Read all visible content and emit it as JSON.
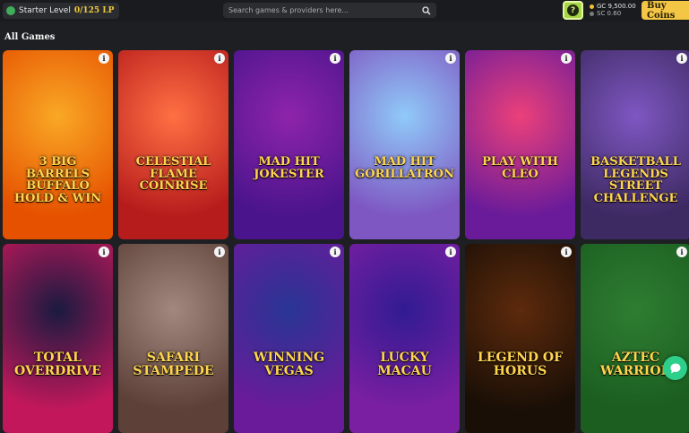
{
  "topbar": {
    "level_label": "Starter Level",
    "level_lp": "0/125 LP",
    "search_placeholder": "Search games & providers here...",
    "help_label": "?",
    "gc_balance": "GC 9,500.00",
    "sc_balance": "SC 0.60",
    "buy_label": "Buy Coins"
  },
  "main": {
    "section_title": "All Games",
    "info_glyph": "i",
    "games": [
      {
        "title": "3 BIG BARRELS BUFFALO HOLD & WIN",
        "colors": [
          "#f9a825",
          "#e65100"
        ]
      },
      {
        "title": "CELESTIAL FLAME COINRISE",
        "colors": [
          "#ff7043",
          "#b71c1c"
        ]
      },
      {
        "title": "MAD HIT JOKESTER",
        "colors": [
          "#8e24aa",
          "#4a148c"
        ]
      },
      {
        "title": "MAD HIT GORILLATRON",
        "colors": [
          "#90caf9",
          "#7e57c2"
        ]
      },
      {
        "title": "PLAY WITH CLEO",
        "colors": [
          "#ec407a",
          "#6a1b9a"
        ]
      },
      {
        "title": "BASKETBALL LEGENDS STREET CHALLENGE",
        "colors": [
          "#7e57c2",
          "#3e2a63"
        ]
      },
      {
        "title": "TOTAL OVERDRIVE",
        "colors": [
          "#1a1a40",
          "#c2185b"
        ]
      },
      {
        "title": "SAFARI STAMPEDE",
        "colors": [
          "#a1887f",
          "#5d4037"
        ]
      },
      {
        "title": "WINNING VEGAS",
        "colors": [
          "#283593",
          "#6a1b9a"
        ]
      },
      {
        "title": "LUCKY MACAU",
        "colors": [
          "#311b92",
          "#7b1fa2"
        ]
      },
      {
        "title": "LEGEND OF HORUS",
        "colors": [
          "#5d2a0c",
          "#1a0f06"
        ]
      },
      {
        "title": "AZTEC WARRIOR",
        "colors": [
          "#2e7d32",
          "#1b5e20"
        ]
      }
    ]
  }
}
